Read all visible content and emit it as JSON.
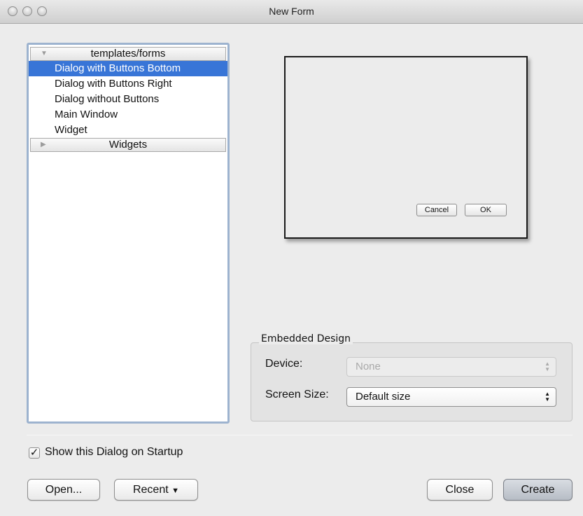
{
  "window": {
    "title": "New Form"
  },
  "tree": {
    "groups": [
      {
        "label": "templates/forms",
        "expanded": true,
        "items": [
          {
            "label": "Dialog with Buttons Bottom",
            "selected": true
          },
          {
            "label": "Dialog with Buttons Right",
            "selected": false
          },
          {
            "label": "Dialog without Buttons",
            "selected": false
          },
          {
            "label": "Main Window",
            "selected": false
          },
          {
            "label": "Widget",
            "selected": false
          }
        ]
      },
      {
        "label": "Widgets",
        "expanded": false
      }
    ]
  },
  "preview": {
    "cancel_label": "Cancel",
    "ok_label": "OK"
  },
  "embedded_design": {
    "title": "Embedded Design",
    "device_label": "Device:",
    "device_value": "None",
    "device_enabled": false,
    "screen_size_label": "Screen Size:",
    "screen_size_value": "Default size"
  },
  "show_on_startup": {
    "label": "Show this Dialog on Startup",
    "checked": true
  },
  "buttons": {
    "open": "Open...",
    "recent": "Recent",
    "close": "Close",
    "create": "Create"
  },
  "colors": {
    "selection": "#3875d7",
    "tree_focus_border": "#9db3cf"
  }
}
